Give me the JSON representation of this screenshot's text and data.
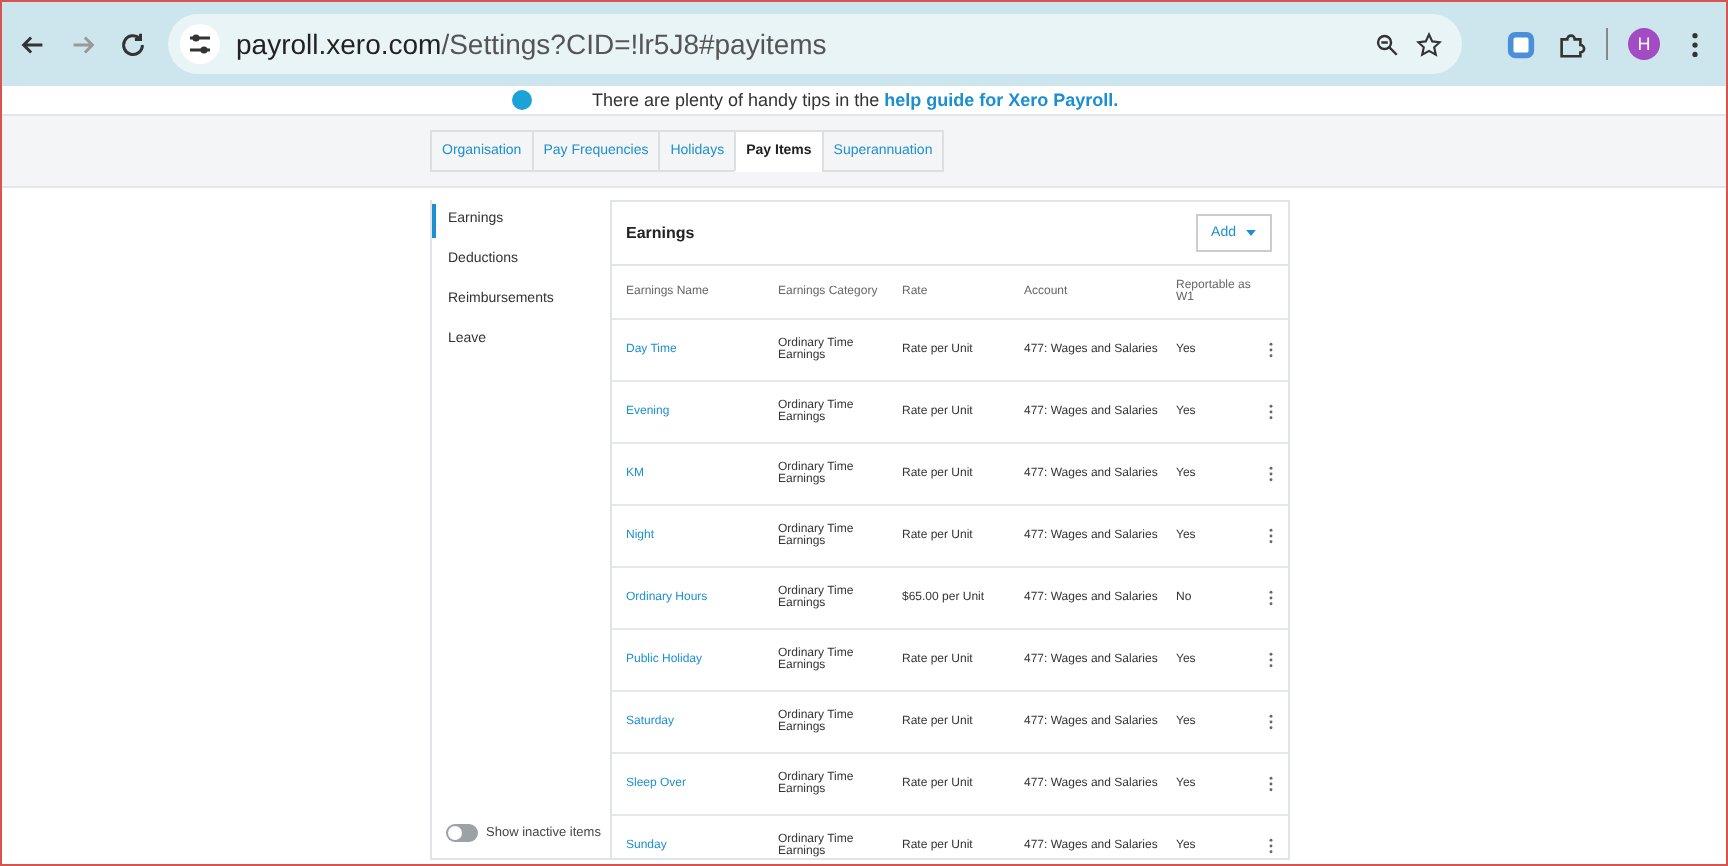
{
  "browser": {
    "url_host": "payroll.xero.com",
    "url_path": "/Settings?CID=!lr5J8#payitems",
    "avatar": "H"
  },
  "banner": {
    "text": "There are plenty of handy tips in the ",
    "link": "help guide for Xero Payroll."
  },
  "tabs": [
    {
      "label": "Organisation",
      "selected": false
    },
    {
      "label": "Pay Frequencies",
      "selected": false
    },
    {
      "label": "Holidays",
      "selected": false
    },
    {
      "label": "Pay Items",
      "selected": true
    },
    {
      "label": "Superannuation",
      "selected": false
    }
  ],
  "sidebar": {
    "items": [
      {
        "label": "Earnings",
        "selected": true
      },
      {
        "label": "Deductions",
        "selected": false
      },
      {
        "label": "Reimbursements",
        "selected": false
      },
      {
        "label": "Leave",
        "selected": false
      }
    ],
    "toggle": {
      "label": "Show inactive items",
      "on": false
    }
  },
  "table": {
    "title": "Earnings",
    "add_button": "Add",
    "columns": [
      "Earnings Name",
      "Earnings Category",
      "Rate",
      "Account",
      "Reportable as W1"
    ],
    "rows": [
      {
        "name": "Day Time",
        "category": "Ordinary Time Earnings",
        "rate": "Rate per Unit",
        "account": "477: Wages and Salaries",
        "reportable": "Yes"
      },
      {
        "name": "Evening",
        "category": "Ordinary Time Earnings",
        "rate": "Rate per Unit",
        "account": "477: Wages and Salaries",
        "reportable": "Yes"
      },
      {
        "name": "KM",
        "category": "Ordinary Time Earnings",
        "rate": "Rate per Unit",
        "account": "477: Wages and Salaries",
        "reportable": "Yes"
      },
      {
        "name": "Night",
        "category": "Ordinary Time Earnings",
        "rate": "Rate per Unit",
        "account": "477: Wages and Salaries",
        "reportable": "Yes"
      },
      {
        "name": "Ordinary Hours",
        "category": "Ordinary Time Earnings",
        "rate": "$65.00 per Unit",
        "account": "477: Wages and Salaries",
        "reportable": "No"
      },
      {
        "name": "Public Holiday",
        "category": "Ordinary Time Earnings",
        "rate": "Rate per Unit",
        "account": "477: Wages and Salaries",
        "reportable": "Yes"
      },
      {
        "name": "Saturday",
        "category": "Ordinary Time Earnings",
        "rate": "Rate per Unit",
        "account": "477: Wages and Salaries",
        "reportable": "Yes"
      },
      {
        "name": "Sleep Over",
        "category": "Ordinary Time Earnings",
        "rate": "Rate per Unit",
        "account": "477: Wages and Salaries",
        "reportable": "Yes"
      },
      {
        "name": "Sunday",
        "category": "Ordinary Time Earnings",
        "rate": "Rate per Unit",
        "account": "477: Wages and Salaries",
        "reportable": "Yes"
      }
    ]
  }
}
